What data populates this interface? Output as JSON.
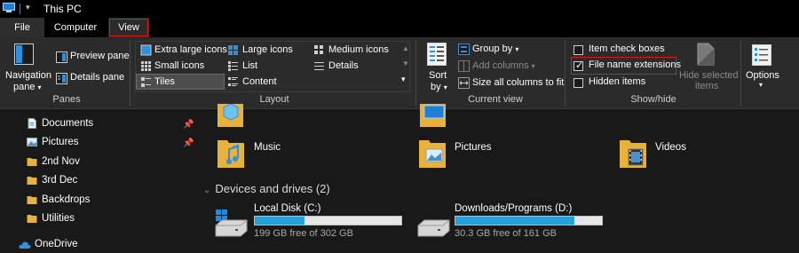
{
  "window": {
    "title": "This PC"
  },
  "tabs": [
    "File",
    "Computer",
    "View"
  ],
  "ribbon": {
    "panes": {
      "navigation_pane": "Navigation",
      "navigation_pane_sub": "pane",
      "preview_pane": "Preview pane",
      "details_pane": "Details pane",
      "label": "Panes"
    },
    "layout": {
      "items": [
        "Extra large icons",
        "Large icons",
        "Medium icons",
        "Small icons",
        "List",
        "Details",
        "Tiles",
        "Content"
      ],
      "selected": "Tiles",
      "label": "Layout"
    },
    "current_view": {
      "sort": "Sort",
      "sort_sub": "by",
      "group_by": "Group by",
      "add_columns": "Add columns",
      "size_all_columns": "Size all columns to fit",
      "label": "Current view"
    },
    "show_hide": {
      "item_check_boxes": "Item check boxes",
      "item_check_boxes_checked": false,
      "file_name_extensions": "File name extensions",
      "file_name_extensions_checked": true,
      "hidden_items": "Hidden items",
      "hidden_items_checked": false,
      "hide_selected_1": "Hide selected",
      "hide_selected_2": "items",
      "label": "Show/hide"
    },
    "options": "Options"
  },
  "nav": [
    {
      "label": "Documents",
      "pinned": true
    },
    {
      "label": "Pictures",
      "pinned": true
    },
    {
      "label": "2nd Nov",
      "pinned": false
    },
    {
      "label": "3rd Dec",
      "pinned": false
    },
    {
      "label": "Backdrops",
      "pinned": false
    },
    {
      "label": "Utilities",
      "pinned": false
    },
    {
      "label": "OneDrive",
      "pinned": false
    }
  ],
  "folders": [
    "Music",
    "Pictures",
    "Videos"
  ],
  "devices": {
    "header": "Devices and drives (2)",
    "drives": [
      {
        "name": "Local Disk (C:)",
        "free": "199 GB free of 302 GB",
        "used_fraction": 0.34
      },
      {
        "name": "Downloads/Programs (D:)",
        "free": "30.3 GB free of 161 GB",
        "used_fraction": 0.81
      }
    ]
  },
  "colors": {
    "highlight": "#d91a1a",
    "accent": "#26a0da",
    "folder": "#e8b23a"
  }
}
